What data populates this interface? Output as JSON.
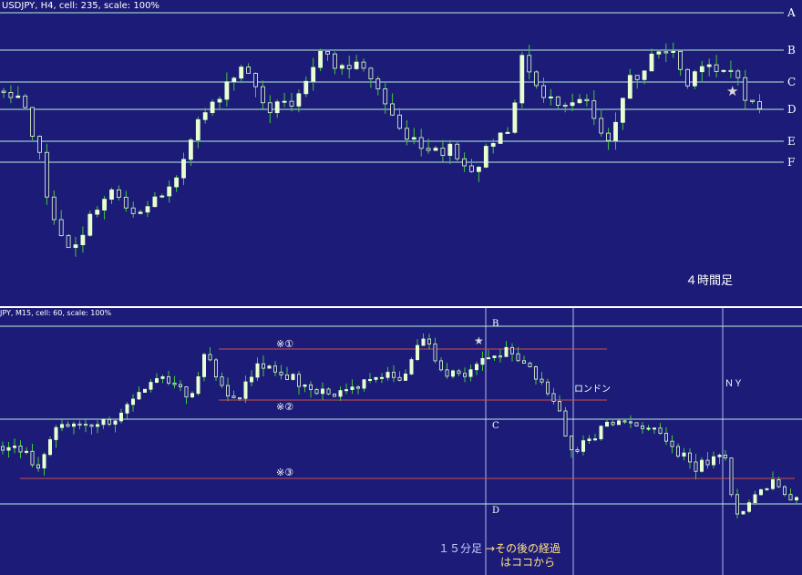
{
  "colors": {
    "background": "#1c1c78",
    "bull_candle": "#e8ffd0",
    "bear_candle": "#e8ffd0",
    "wick": "#3ec83e",
    "level_line": "#b8f0d8",
    "red_line": "#c85050",
    "vline": "#b0b8e8",
    "label_text": "#ffffff",
    "note_accent": "#ffe080",
    "star": "#d8d8d8"
  },
  "h4_chart": {
    "header": "USDJPY, H4, cell: 235, scale: 100%",
    "timeframe_label": "４時間足",
    "levels": [
      {
        "label": "A"
      },
      {
        "label": "B"
      },
      {
        "label": "C"
      },
      {
        "label": "D"
      },
      {
        "label": "E"
      },
      {
        "label": "F"
      }
    ],
    "star": "★"
  },
  "m15_chart": {
    "header": "JPY, M15, cell: 60, scale: 100%",
    "levels": [
      {
        "label": "B"
      },
      {
        "label": "C"
      },
      {
        "label": "D"
      }
    ],
    "marks": [
      {
        "label": "※①"
      },
      {
        "label": "※②"
      },
      {
        "label": "※③"
      }
    ],
    "session_labels": {
      "london": "ロンドン",
      "ny": "ＮＹ"
    },
    "timeframe_label": "１５分足",
    "note_line1": "→その後の経過",
    "note_line2": "はココから",
    "star": "★"
  }
}
